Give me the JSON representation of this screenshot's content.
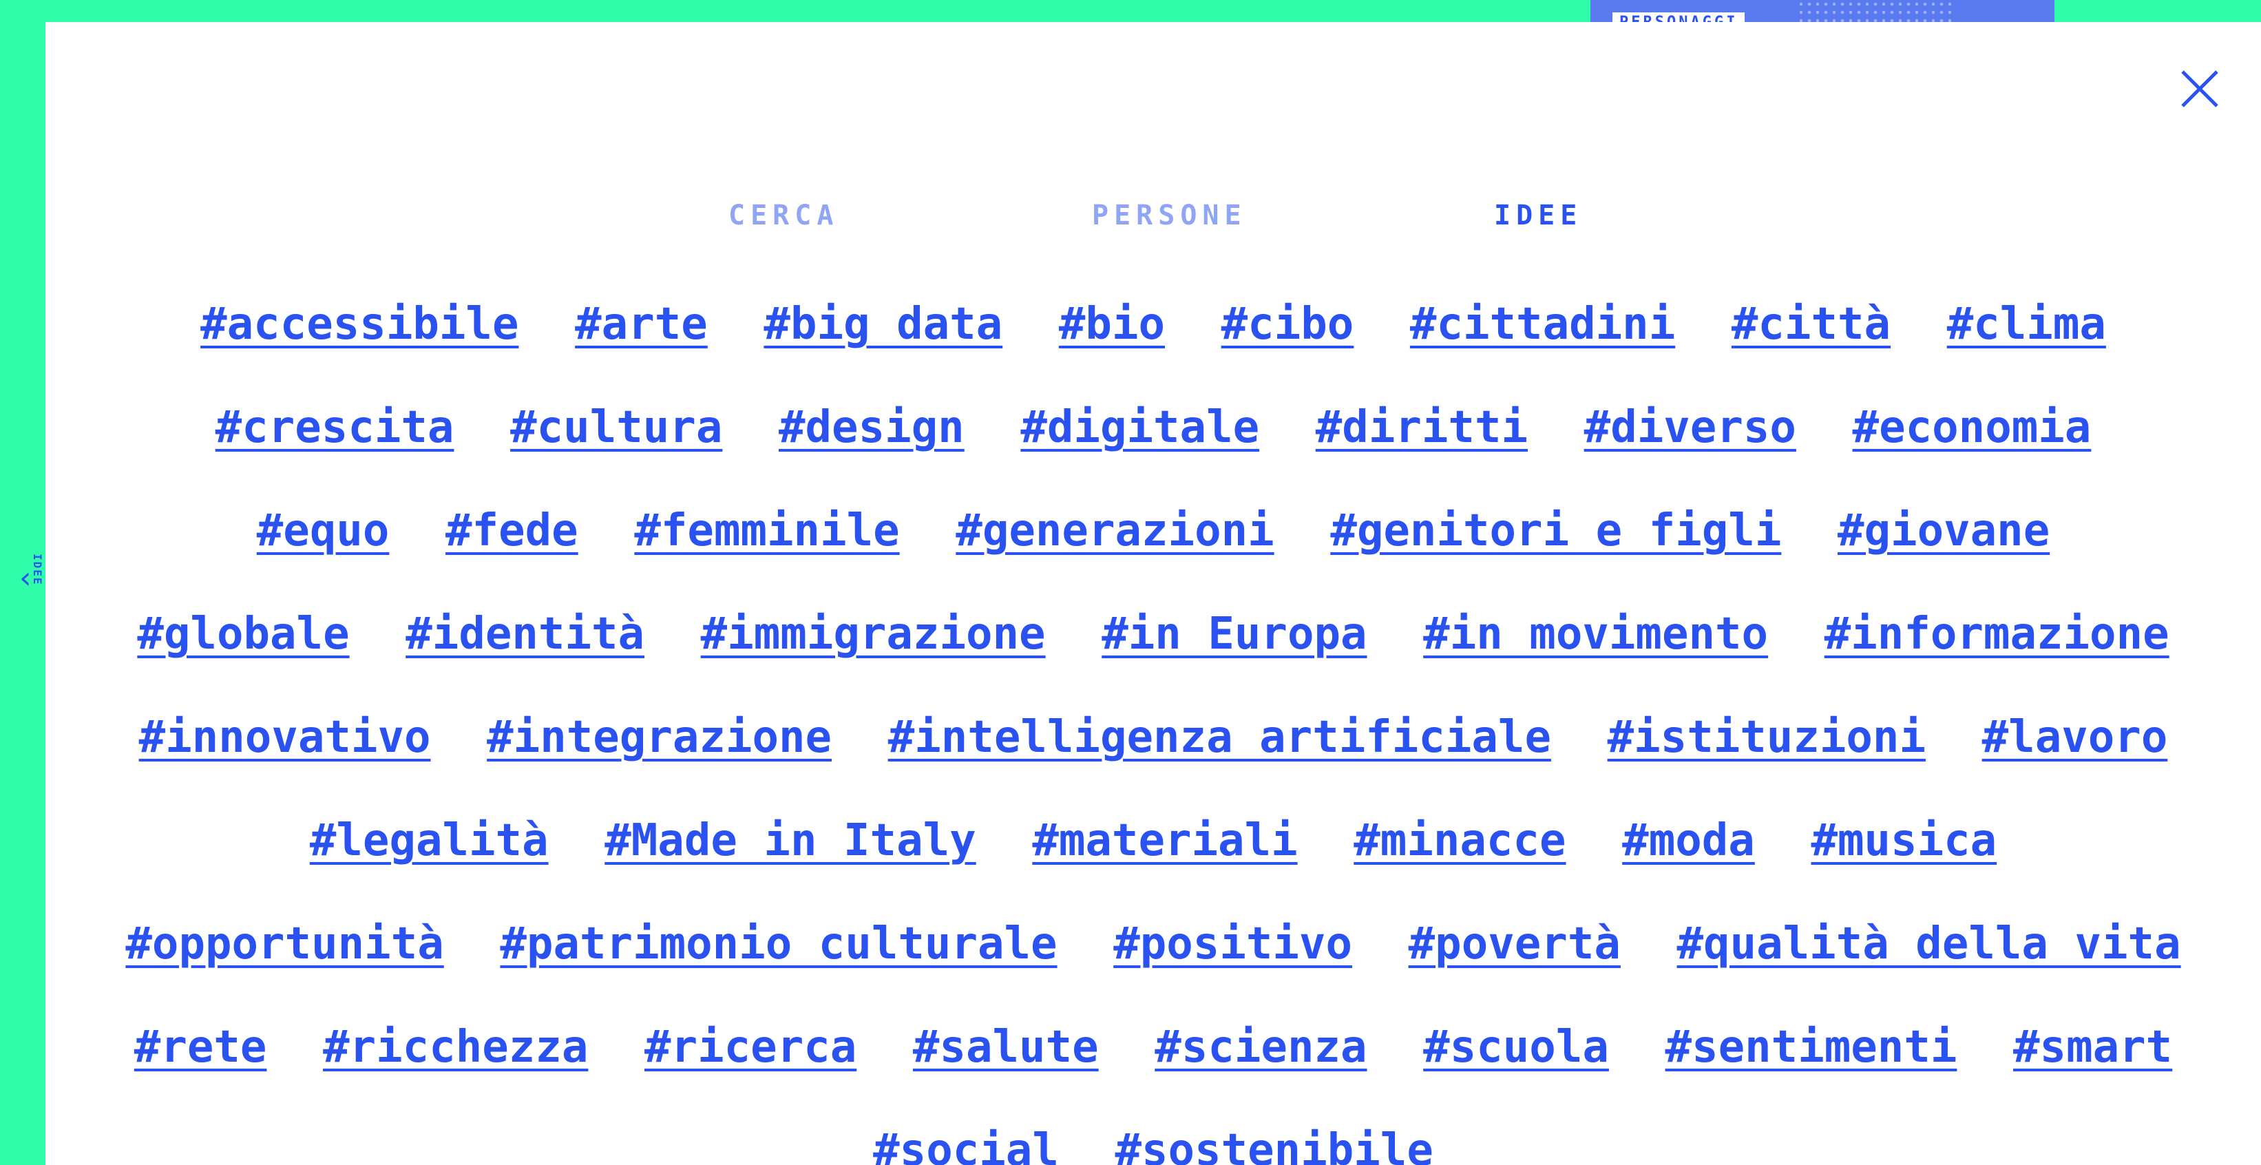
{
  "background": {
    "accent": "#2ffdaa",
    "card_label": "PERSONAGGI"
  },
  "side_tab": {
    "label": "IDEE",
    "icon": "chevron-left-icon"
  },
  "modal": {
    "close_icon": "close-icon",
    "tabs": [
      {
        "label": "CERCA",
        "active": false
      },
      {
        "label": "PERSONE",
        "active": false
      },
      {
        "label": "IDEE",
        "active": true
      }
    ],
    "tags": [
      "#accessibile",
      "#arte",
      "#big data",
      "#bio",
      "#cibo",
      "#cittadini",
      "#città",
      "#clima",
      "#crescita",
      "#cultura",
      "#design",
      "#digitale",
      "#diritti",
      "#diverso",
      "#economia",
      "#equo",
      "#fede",
      "#femminile",
      "#generazioni",
      "#genitori e figli",
      "#giovane",
      "#globale",
      "#identità",
      "#immigrazione",
      "#in Europa",
      "#in movimento",
      "#informazione",
      "#innovativo",
      "#integrazione",
      "#intelligenza artificiale",
      "#istituzioni",
      "#lavoro",
      "#legalità",
      "#Made in Italy",
      "#materiali",
      "#minacce",
      "#moda",
      "#musica",
      "#opportunità",
      "#patrimonio culturale",
      "#positivo",
      "#povertà",
      "#qualità della vita",
      "#rete",
      "#ricchezza",
      "#ricerca",
      "#salute",
      "#scienza",
      "#scuola",
      "#sentimenti",
      "#smart",
      "#social",
      "#sostenibile"
    ]
  },
  "colors": {
    "link": "#2a52f0",
    "tab_inactive": "#8ea6f5",
    "modal_bg": "#ffffff"
  }
}
